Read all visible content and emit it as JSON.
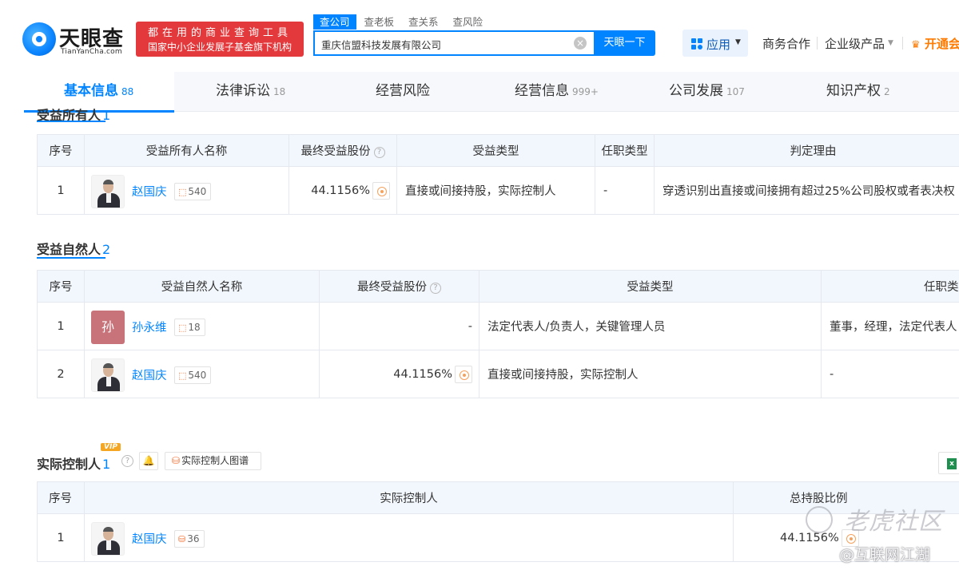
{
  "header": {
    "logo_cn": "天眼查",
    "logo_en": "TianYanCha.com",
    "slogan_line1": "都在用的商业查询工具",
    "slogan_line2": "国家中小企业发展子基金旗下机构",
    "search_tabs": [
      "查公司",
      "查老板",
      "查关系",
      "查风险"
    ],
    "search_value": "重庆信盟科技发展有限公司",
    "search_button": "天眼一下",
    "app_label": "应用",
    "nav": [
      "商务合作",
      "企业级产品"
    ],
    "vip_label": "开通会"
  },
  "tabs": [
    {
      "label": "基本信息",
      "count": "88"
    },
    {
      "label": "法律诉讼",
      "count": "18"
    },
    {
      "label": "经营风险",
      "count": ""
    },
    {
      "label": "经营信息",
      "count": "999+"
    },
    {
      "label": "公司发展",
      "count": "107"
    },
    {
      "label": "知识产权",
      "count": "2"
    }
  ],
  "beneficial_owners": {
    "title": "受益所有人",
    "count": "1",
    "headers": [
      "序号",
      "受益所有人名称",
      "最终受益股份",
      "受益类型",
      "任职类型",
      "判定理由"
    ],
    "rows": [
      {
        "index": "1",
        "name": "赵国庆",
        "tag": "540",
        "percent": "44.1156%",
        "type": "直接或间接持股，实际控制人",
        "role": "-",
        "reason": "穿透识别出直接或间接拥有超过25%公司股权或者表决权"
      }
    ]
  },
  "beneficial_persons": {
    "title": "受益自然人",
    "count": "2",
    "headers": [
      "序号",
      "受益自然人名称",
      "最终受益股份",
      "受益类型",
      "任职类"
    ],
    "rows": [
      {
        "index": "1",
        "avatar_text": "孙",
        "name": "孙永维",
        "tag": "18",
        "percent": "-",
        "type": "法定代表人/负责人，关键管理人员",
        "role": "董事，经理，法定代表人"
      },
      {
        "index": "2",
        "avatar_text": "",
        "name": "赵国庆",
        "tag": "540",
        "percent": "44.1156%",
        "type": "直接或间接持股，实际控制人",
        "role": "-"
      }
    ]
  },
  "controller": {
    "title": "实际控制人",
    "count": "1",
    "vip_badge": "VIP",
    "help": "?",
    "graph_button": "实际控制人图谱",
    "headers": [
      "序号",
      "实际控制人",
      "总持股比例"
    ],
    "rows": [
      {
        "index": "1",
        "name": "赵国庆",
        "tag": "36",
        "percent": "44.1156%"
      }
    ]
  },
  "watermark": {
    "line1": "老虎社区",
    "line2": "@互联网江湖"
  },
  "colors": {
    "accent": "#0084ff",
    "slogan_bg": "#e4393c",
    "vip": "#ff7a00"
  }
}
